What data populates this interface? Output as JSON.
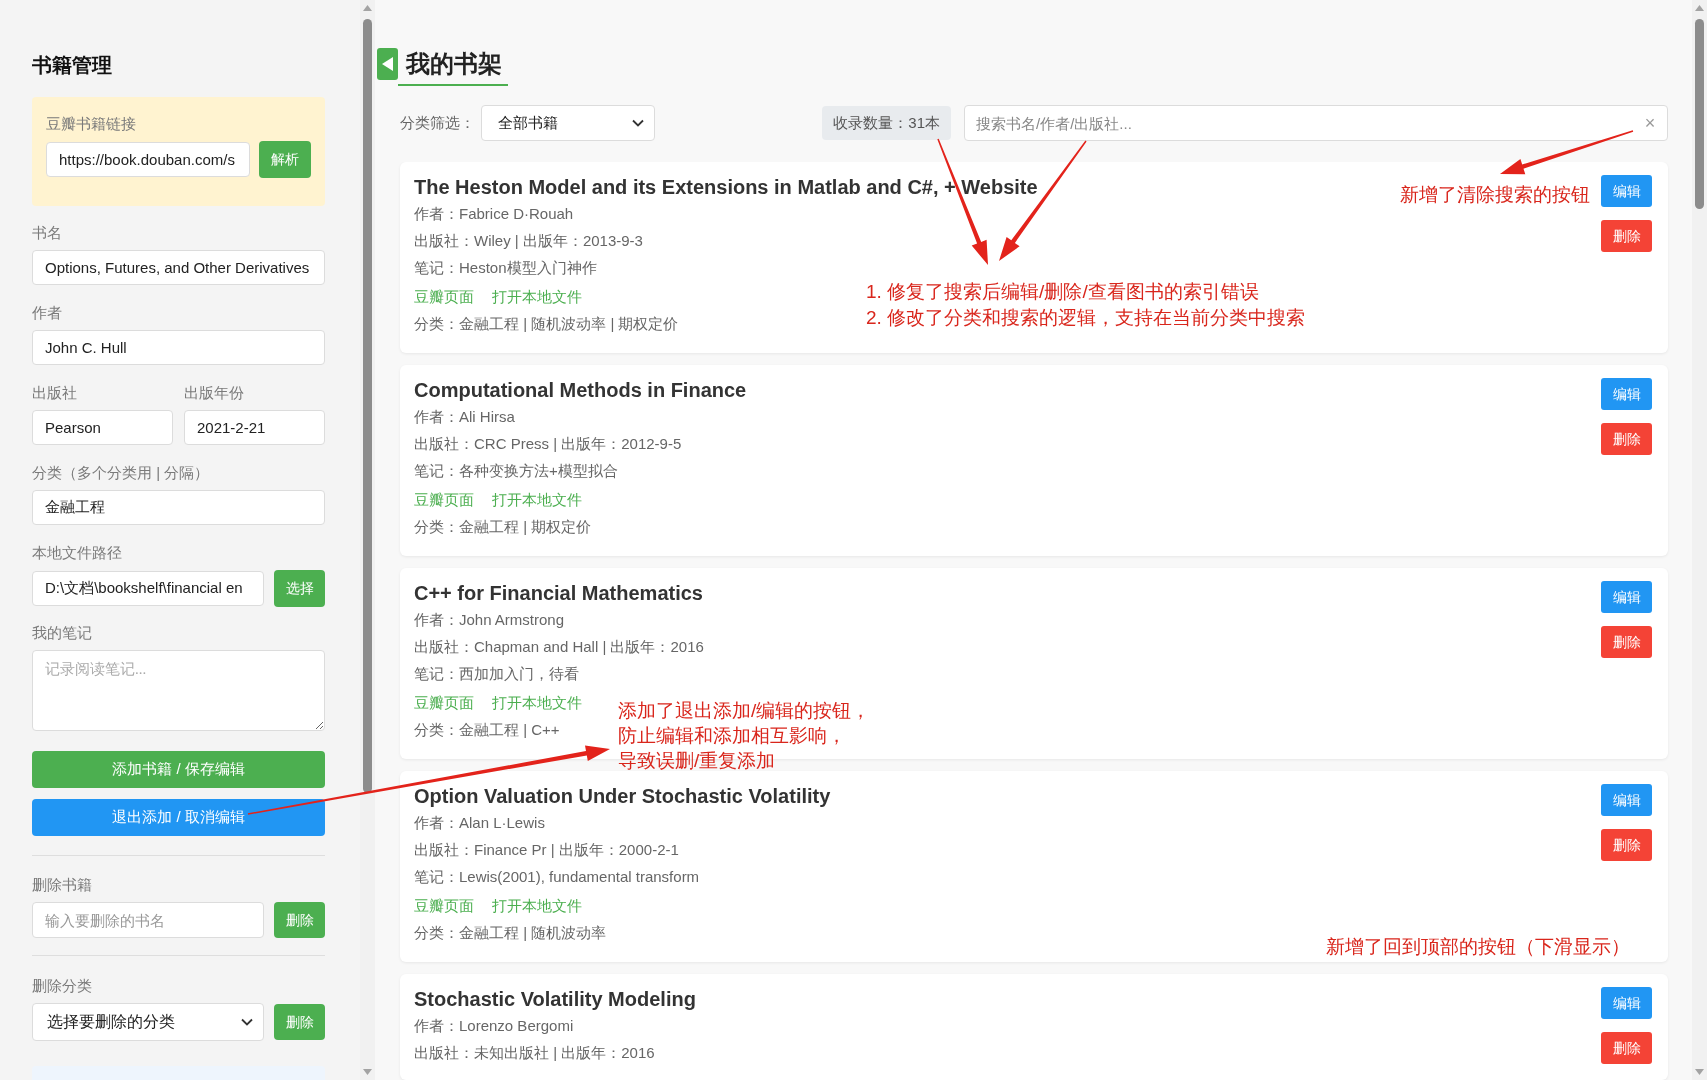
{
  "sidebar": {
    "title": "书籍管理",
    "douban": {
      "label": "豆瓣书籍链接",
      "value": "https://book.douban.com/s",
      "button": "解析"
    },
    "form": [
      {
        "kind": "input",
        "label": "书名",
        "value": "Options, Futures, and Other Derivatives"
      },
      {
        "kind": "input",
        "label": "作者",
        "value": "John C. Hull"
      },
      {
        "kind": "pair",
        "items": [
          {
            "label": "出版社",
            "value": "Pearson"
          },
          {
            "label": "出版年份",
            "value": "2021-2-21"
          }
        ]
      },
      {
        "kind": "input",
        "label": "分类（多个分类用 | 分隔）",
        "value": "金融工程"
      },
      {
        "kind": "input_button",
        "label": "本地文件路径",
        "value": "D:\\文档\\bookshelf\\financial en",
        "button": "选择"
      },
      {
        "kind": "textarea",
        "label": "我的笔记",
        "placeholder": "记录阅读笔记..."
      }
    ],
    "actions": [
      {
        "kind": "save",
        "label": "添加书籍 / 保存编辑"
      },
      {
        "kind": "cancel",
        "label": "退出添加 / 取消编辑"
      }
    ],
    "delete_book": {
      "label": "删除书籍",
      "placeholder": "输入要删除的书名",
      "button": "删除"
    },
    "delete_category": {
      "label": "删除分类",
      "value": "选择要删除的分类",
      "button": "删除"
    }
  },
  "shelf": {
    "title": "我的书架",
    "filter": {
      "label": "分类筛选：",
      "value": "全部书籍"
    },
    "count": "收录数量：31本",
    "search": {
      "placeholder": "搜索书名/作者/出版社...",
      "clear": "×"
    },
    "books": [
      {
        "title": "The Heston Model and its Extensions in Matlab and C#, + Website",
        "author": "作者：Fabrice D·Rouah",
        "publisher": "出版社：Wiley | 出版年：2013-9-3",
        "note": "笔记：Heston模型入门神作",
        "links": [
          "豆瓣页面",
          "打开本地文件"
        ],
        "categories": "分类：金融工程 | 随机波动率 | 期权定价",
        "actions": [
          {
            "kind": "edit",
            "label": "编辑"
          },
          {
            "kind": "delete",
            "label": "删除"
          }
        ]
      },
      {
        "title": "Computational Methods in Finance",
        "author": "作者：Ali Hirsa",
        "publisher": "出版社：CRC Press | 出版年：2012-9-5",
        "note": "笔记：各种变换方法+模型拟合",
        "links": [
          "豆瓣页面",
          "打开本地文件"
        ],
        "categories": "分类：金融工程 | 期权定价",
        "actions": [
          {
            "kind": "edit",
            "label": "编辑"
          },
          {
            "kind": "delete",
            "label": "删除"
          }
        ]
      },
      {
        "title": "C++ for Financial Mathematics",
        "author": "作者：John Armstrong",
        "publisher": "出版社：Chapman and Hall | 出版年：2016",
        "note": "笔记：西加加入门，待看",
        "links": [
          "豆瓣页面",
          "打开本地文件"
        ],
        "categories": "分类：金融工程 | C++",
        "actions": [
          {
            "kind": "edit",
            "label": "编辑"
          },
          {
            "kind": "delete",
            "label": "删除"
          }
        ]
      },
      {
        "title": "Option Valuation Under Stochastic Volatility",
        "author": "作者：Alan L·Lewis",
        "publisher": "出版社：Finance Pr | 出版年：2000-2-1",
        "note": "笔记：Lewis(2001), fundamental transform",
        "links": [
          "豆瓣页面",
          "打开本地文件"
        ],
        "categories": "分类：金融工程 | 随机波动率",
        "actions": [
          {
            "kind": "edit",
            "label": "编辑"
          },
          {
            "kind": "delete",
            "label": "删除"
          }
        ]
      },
      {
        "title": "Stochastic Volatility Modeling",
        "author": "作者：Lorenzo Bergomi",
        "publisher": "出版社：未知出版社 | 出版年：2016",
        "actions": [
          {
            "kind": "edit",
            "label": "编辑"
          },
          {
            "kind": "delete",
            "label": "删除"
          }
        ]
      }
    ]
  },
  "annotations": [
    {
      "kind": "note",
      "lines": [
        "新增了清除搜索的按钮"
      ]
    },
    {
      "kind": "list",
      "lines": [
        "1. 修复了搜索后编辑/删除/查看图书的索引错误",
        "2. 修改了分类和搜索的逻辑，支持在当前分类中搜索"
      ]
    },
    {
      "kind": "note",
      "lines": [
        "添加了退出添加/编辑的按钮，",
        "防止编辑和添加相互影响，",
        "导致误删/重复添加"
      ]
    },
    {
      "kind": "note",
      "lines": [
        "新增了回到顶部的按钮（下滑显示）"
      ]
    }
  ]
}
